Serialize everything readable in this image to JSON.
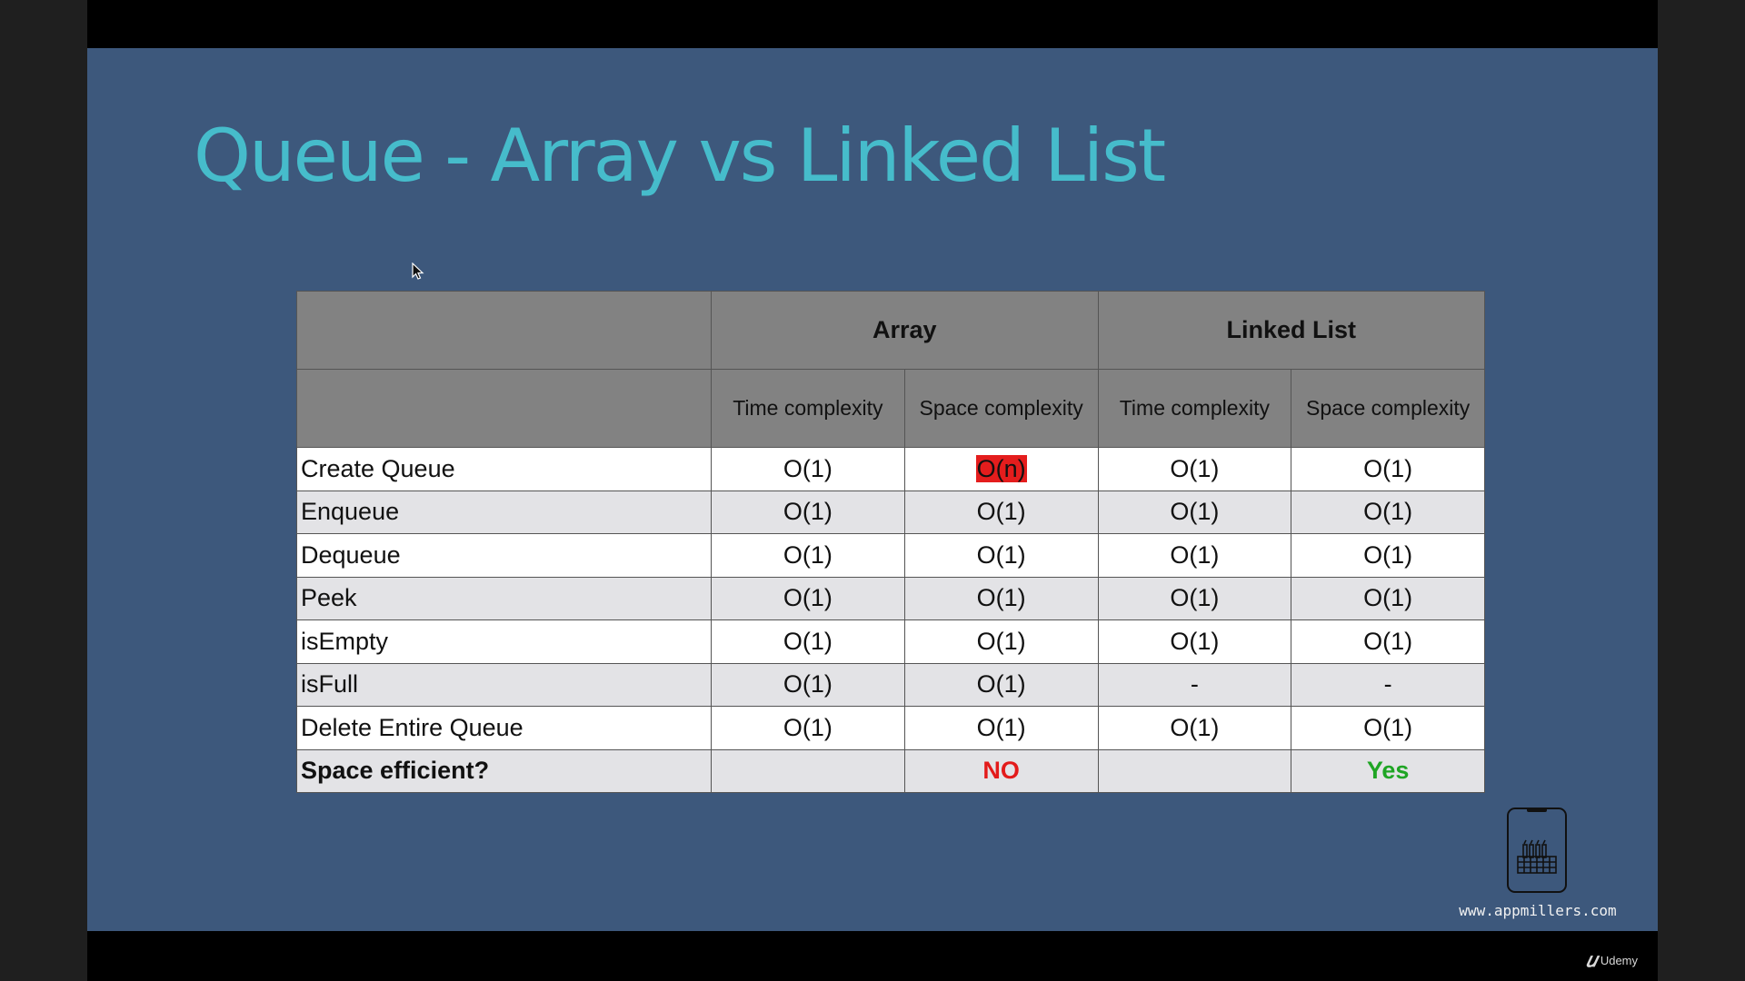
{
  "slide": {
    "title": "Queue - Array vs Linked List",
    "colors": {
      "background": "#3d587c",
      "title": "#46bccb",
      "header": "#828282",
      "highlight": "#e41d1d",
      "no": "#e31b1b",
      "yes": "#1fa524"
    }
  },
  "table": {
    "groups": [
      "",
      "Array",
      "Linked List"
    ],
    "subheaders": [
      "",
      "Time complexity",
      "Space complexity",
      "Time complexity",
      "Space complexity"
    ],
    "rows": [
      {
        "label": "Create Queue",
        "cells": [
          "O(1)",
          "O(n)",
          "O(1)",
          "O(1)"
        ]
      },
      {
        "label": "Enqueue",
        "cells": [
          "O(1)",
          "O(1)",
          "O(1)",
          "O(1)"
        ]
      },
      {
        "label": "Dequeue",
        "cells": [
          "O(1)",
          "O(1)",
          "O(1)",
          "O(1)"
        ]
      },
      {
        "label": "Peek",
        "cells": [
          "O(1)",
          "O(1)",
          "O(1)",
          "O(1)"
        ]
      },
      {
        "label": "isEmpty",
        "cells": [
          "O(1)",
          "O(1)",
          "O(1)",
          "O(1)"
        ]
      },
      {
        "label": "isFull",
        "cells": [
          "O(1)",
          "O(1)",
          "-",
          "-"
        ]
      },
      {
        "label": "Delete Entire Queue",
        "cells": [
          "O(1)",
          "O(1)",
          "O(1)",
          "O(1)"
        ]
      },
      {
        "label": "Space efficient?",
        "cells": [
          "",
          "NO",
          "",
          "Yes"
        ]
      }
    ]
  },
  "branding": {
    "website": "www.appmillers.com",
    "logo_icon": "phone-factory-icon",
    "player": "Udemy",
    "player_icon": "udemy-logo-icon"
  }
}
